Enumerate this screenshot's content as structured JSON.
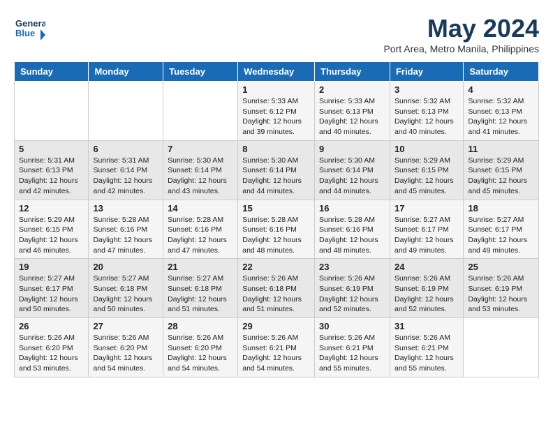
{
  "logo": {
    "name": "GeneralBlue",
    "line1": "General",
    "line2": "Blue"
  },
  "header": {
    "month": "May 2024",
    "location": "Port Area, Metro Manila, Philippines"
  },
  "days_of_week": [
    "Sunday",
    "Monday",
    "Tuesday",
    "Wednesday",
    "Thursday",
    "Friday",
    "Saturday"
  ],
  "weeks": [
    [
      {
        "day": "",
        "info": ""
      },
      {
        "day": "",
        "info": ""
      },
      {
        "day": "",
        "info": ""
      },
      {
        "day": "1",
        "info": "Sunrise: 5:33 AM\nSunset: 6:12 PM\nDaylight: 12 hours\nand 39 minutes."
      },
      {
        "day": "2",
        "info": "Sunrise: 5:33 AM\nSunset: 6:13 PM\nDaylight: 12 hours\nand 40 minutes."
      },
      {
        "day": "3",
        "info": "Sunrise: 5:32 AM\nSunset: 6:13 PM\nDaylight: 12 hours\nand 40 minutes."
      },
      {
        "day": "4",
        "info": "Sunrise: 5:32 AM\nSunset: 6:13 PM\nDaylight: 12 hours\nand 41 minutes."
      }
    ],
    [
      {
        "day": "5",
        "info": "Sunrise: 5:31 AM\nSunset: 6:13 PM\nDaylight: 12 hours\nand 42 minutes."
      },
      {
        "day": "6",
        "info": "Sunrise: 5:31 AM\nSunset: 6:14 PM\nDaylight: 12 hours\nand 42 minutes."
      },
      {
        "day": "7",
        "info": "Sunrise: 5:30 AM\nSunset: 6:14 PM\nDaylight: 12 hours\nand 43 minutes."
      },
      {
        "day": "8",
        "info": "Sunrise: 5:30 AM\nSunset: 6:14 PM\nDaylight: 12 hours\nand 44 minutes."
      },
      {
        "day": "9",
        "info": "Sunrise: 5:30 AM\nSunset: 6:14 PM\nDaylight: 12 hours\nand 44 minutes."
      },
      {
        "day": "10",
        "info": "Sunrise: 5:29 AM\nSunset: 6:15 PM\nDaylight: 12 hours\nand 45 minutes."
      },
      {
        "day": "11",
        "info": "Sunrise: 5:29 AM\nSunset: 6:15 PM\nDaylight: 12 hours\nand 45 minutes."
      }
    ],
    [
      {
        "day": "12",
        "info": "Sunrise: 5:29 AM\nSunset: 6:15 PM\nDaylight: 12 hours\nand 46 minutes."
      },
      {
        "day": "13",
        "info": "Sunrise: 5:28 AM\nSunset: 6:16 PM\nDaylight: 12 hours\nand 47 minutes."
      },
      {
        "day": "14",
        "info": "Sunrise: 5:28 AM\nSunset: 6:16 PM\nDaylight: 12 hours\nand 47 minutes."
      },
      {
        "day": "15",
        "info": "Sunrise: 5:28 AM\nSunset: 6:16 PM\nDaylight: 12 hours\nand 48 minutes."
      },
      {
        "day": "16",
        "info": "Sunrise: 5:28 AM\nSunset: 6:16 PM\nDaylight: 12 hours\nand 48 minutes."
      },
      {
        "day": "17",
        "info": "Sunrise: 5:27 AM\nSunset: 6:17 PM\nDaylight: 12 hours\nand 49 minutes."
      },
      {
        "day": "18",
        "info": "Sunrise: 5:27 AM\nSunset: 6:17 PM\nDaylight: 12 hours\nand 49 minutes."
      }
    ],
    [
      {
        "day": "19",
        "info": "Sunrise: 5:27 AM\nSunset: 6:17 PM\nDaylight: 12 hours\nand 50 minutes."
      },
      {
        "day": "20",
        "info": "Sunrise: 5:27 AM\nSunset: 6:18 PM\nDaylight: 12 hours\nand 50 minutes."
      },
      {
        "day": "21",
        "info": "Sunrise: 5:27 AM\nSunset: 6:18 PM\nDaylight: 12 hours\nand 51 minutes."
      },
      {
        "day": "22",
        "info": "Sunrise: 5:26 AM\nSunset: 6:18 PM\nDaylight: 12 hours\nand 51 minutes."
      },
      {
        "day": "23",
        "info": "Sunrise: 5:26 AM\nSunset: 6:19 PM\nDaylight: 12 hours\nand 52 minutes."
      },
      {
        "day": "24",
        "info": "Sunrise: 5:26 AM\nSunset: 6:19 PM\nDaylight: 12 hours\nand 52 minutes."
      },
      {
        "day": "25",
        "info": "Sunrise: 5:26 AM\nSunset: 6:19 PM\nDaylight: 12 hours\nand 53 minutes."
      }
    ],
    [
      {
        "day": "26",
        "info": "Sunrise: 5:26 AM\nSunset: 6:20 PM\nDaylight: 12 hours\nand 53 minutes."
      },
      {
        "day": "27",
        "info": "Sunrise: 5:26 AM\nSunset: 6:20 PM\nDaylight: 12 hours\nand 54 minutes."
      },
      {
        "day": "28",
        "info": "Sunrise: 5:26 AM\nSunset: 6:20 PM\nDaylight: 12 hours\nand 54 minutes."
      },
      {
        "day": "29",
        "info": "Sunrise: 5:26 AM\nSunset: 6:21 PM\nDaylight: 12 hours\nand 54 minutes."
      },
      {
        "day": "30",
        "info": "Sunrise: 5:26 AM\nSunset: 6:21 PM\nDaylight: 12 hours\nand 55 minutes."
      },
      {
        "day": "31",
        "info": "Sunrise: 5:26 AM\nSunset: 6:21 PM\nDaylight: 12 hours\nand 55 minutes."
      },
      {
        "day": "",
        "info": ""
      }
    ]
  ]
}
